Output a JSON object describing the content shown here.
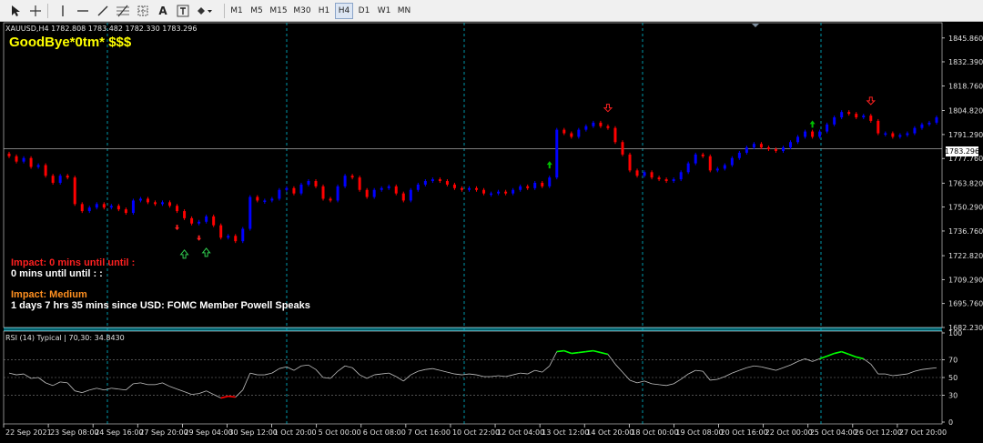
{
  "toolbar": {
    "tools": [
      {
        "name": "cursor-icon"
      },
      {
        "name": "crosshair-icon"
      },
      {
        "name": "vertical-line-icon"
      },
      {
        "name": "horizontal-line-icon"
      },
      {
        "name": "trendline-icon"
      },
      {
        "name": "fibonacci-icon",
        "label": "F"
      },
      {
        "name": "grid-channel-icon"
      },
      {
        "name": "text-icon",
        "label": "A"
      },
      {
        "name": "text-label-icon",
        "label": "T"
      },
      {
        "name": "shapes-dropdown-icon"
      }
    ],
    "timeframes": [
      "M1",
      "M5",
      "M15",
      "M30",
      "H1",
      "H4",
      "D1",
      "W1",
      "MN"
    ],
    "active_timeframe": "H4"
  },
  "chart": {
    "symbol_line": "XAUUSD,H4  1782.808 1783.482 1782.330 1783.296",
    "current_price": "1783.296",
    "logo_text": "GoodBye*0tm* $$$",
    "news": {
      "impact1": "Impact: 0 mins until until :",
      "impact1_detail": "0 mins until until : :",
      "impact2": "Impact: Medium",
      "impact2_detail": "1 days 7 hrs 35 mins since USD: FOMC Member Powell Speaks"
    },
    "rsi_label": "RSI (14) Typical | 70,30: 34.8430",
    "colors": {
      "bull": "#0000ff",
      "bear": "#ff0000",
      "grid": "#00bcd4",
      "rsi_line": "#c0c0c0",
      "rsi_over": "#00ff00",
      "rsi_under": "#ff0000"
    }
  },
  "chart_data": {
    "type": "candlestick",
    "price_axis_labels": [
      "1845.860",
      "1832.390",
      "1818.760",
      "1804.820",
      "1791.290",
      "1777.760",
      "1763.820",
      "1750.290",
      "1736.760",
      "1722.820",
      "1709.290",
      "1695.760",
      "1682.230"
    ],
    "rsi_axis_labels": [
      "100",
      "70",
      "50",
      "30",
      "0"
    ],
    "time_axis_labels": [
      "22 Sep 2021",
      "23 Sep 08:00",
      "24 Sep 16:00",
      "27 Sep 20:00",
      "29 Sep 04:00",
      "30 Sep 12:00",
      "1 Oct 20:00",
      "5 Oct 00:00",
      "6 Oct 08:00",
      "7 Oct 16:00",
      "10 Oct 22:00",
      "12 Oct 04:00",
      "13 Oct 12:00",
      "14 Oct 20:00",
      "18 Oct 00:00",
      "19 Oct 08:00",
      "20 Oct 16:00",
      "22 Oct 00:00",
      "25 Oct 04:00",
      "26 Oct 12:00",
      "27 Oct 20:00"
    ],
    "price_range": [
      1682.23,
      1855.0
    ],
    "rsi_levels": [
      70,
      50,
      30
    ],
    "current_price": 1783.296,
    "candle_closes": [
      1779,
      1776,
      1778,
      1773,
      1774,
      1768,
      1764,
      1768,
      1767,
      1752,
      1748,
      1750,
      1752,
      1750,
      1751,
      1749,
      1747,
      1754,
      1755,
      1753,
      1752,
      1753,
      1751,
      1748,
      1744,
      1741,
      1742,
      1745,
      1740,
      1733,
      1734,
      1731,
      1738,
      1756,
      1754,
      1754,
      1755,
      1760,
      1761,
      1758,
      1763,
      1765,
      1762,
      1755,
      1754,
      1762,
      1768,
      1767,
      1760,
      1756,
      1760,
      1761,
      1762,
      1758,
      1754,
      1760,
      1763,
      1765,
      1766,
      1765,
      1763,
      1761,
      1760,
      1761,
      1760,
      1758,
      1758,
      1759,
      1758,
      1760,
      1762,
      1761,
      1764,
      1762,
      1767,
      1794,
      1792,
      1790,
      1794,
      1796,
      1798,
      1796,
      1795,
      1787,
      1780,
      1771,
      1768,
      1770,
      1767,
      1766,
      1765,
      1766,
      1770,
      1775,
      1780,
      1779,
      1771,
      1772,
      1774,
      1778,
      1781,
      1784,
      1786,
      1784,
      1783,
      1782,
      1784,
      1787,
      1790,
      1793,
      1790,
      1793,
      1797,
      1801,
      1804,
      1803,
      1801,
      1802,
      1799,
      1792,
      1792,
      1790,
      1791,
      1792,
      1795,
      1797,
      1798,
      1801
    ],
    "rsi_values": [
      55,
      53,
      54,
      49,
      50,
      44,
      41,
      45,
      44,
      35,
      33,
      36,
      38,
      36,
      38,
      37,
      36,
      43,
      44,
      42,
      42,
      44,
      40,
      37,
      34,
      31,
      32,
      35,
      31,
      27,
      29,
      28,
      36,
      55,
      53,
      53,
      55,
      60,
      62,
      58,
      63,
      64,
      59,
      50,
      49,
      57,
      63,
      61,
      53,
      49,
      53,
      54,
      55,
      51,
      46,
      53,
      57,
      59,
      60,
      58,
      56,
      54,
      53,
      54,
      53,
      51,
      51,
      52,
      51,
      53,
      55,
      54,
      58,
      56,
      63,
      79,
      80,
      77,
      78,
      79,
      80,
      78,
      76,
      65,
      56,
      47,
      44,
      46,
      43,
      42,
      41,
      43,
      48,
      54,
      58,
      57,
      47,
      48,
      51,
      55,
      58,
      61,
      63,
      62,
      60,
      58,
      61,
      64,
      68,
      71,
      68,
      71,
      74,
      77,
      79,
      76,
      73,
      71,
      65,
      54,
      54,
      52,
      53,
      54,
      57,
      59,
      60,
      61
    ],
    "arrows": [
      {
        "type": "up-green-small",
        "candle": 74
      },
      {
        "type": "down-red-outline",
        "candle": 82
      },
      {
        "type": "up-green-small",
        "candle": 110
      },
      {
        "type": "down-red-outline",
        "candle": 118
      },
      {
        "type": "up-green-outline",
        "candle": 24
      },
      {
        "type": "up-green-outline",
        "candle": 27
      },
      {
        "type": "down-red-small",
        "candle": 23
      },
      {
        "type": "down-red-small",
        "candle": 26
      }
    ]
  }
}
